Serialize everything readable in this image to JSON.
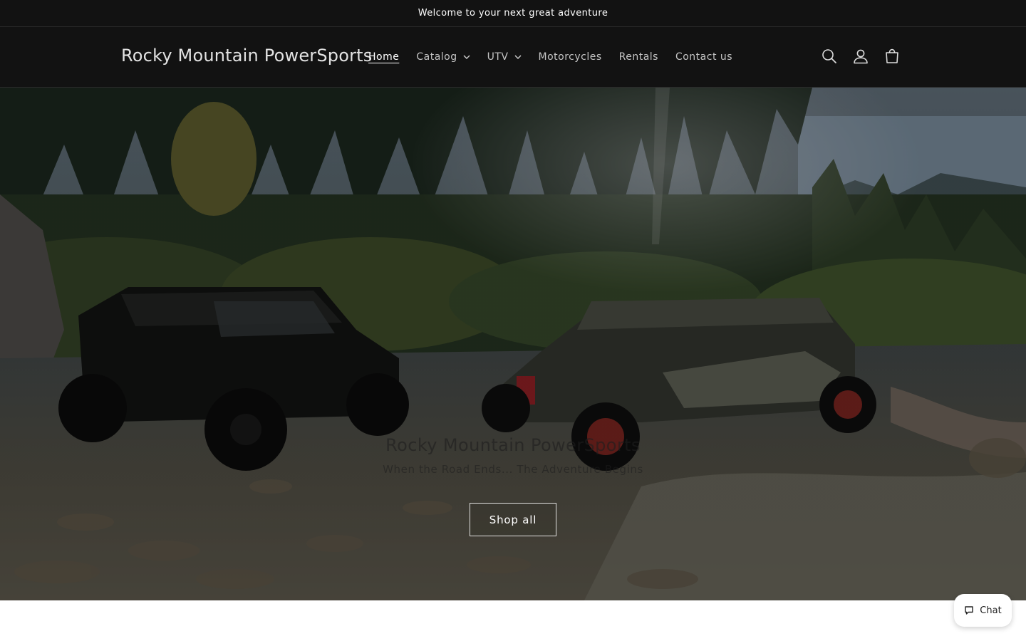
{
  "announcement": {
    "text": "Welcome to your next great adventure"
  },
  "header": {
    "brand": "Rocky Mountain PowerSports",
    "nav": [
      {
        "label": "Home",
        "active": true,
        "has_dropdown": false
      },
      {
        "label": "Catalog",
        "active": false,
        "has_dropdown": true
      },
      {
        "label": "UTV",
        "active": false,
        "has_dropdown": true
      },
      {
        "label": "Motorcycles",
        "active": false,
        "has_dropdown": false
      },
      {
        "label": "Rentals",
        "active": false,
        "has_dropdown": false
      },
      {
        "label": "Contact us",
        "active": false,
        "has_dropdown": false
      }
    ],
    "icons": [
      "search-icon",
      "account-icon",
      "cart-icon"
    ]
  },
  "hero": {
    "title": "Rocky Mountain PowerSports",
    "subtitle": "When the Road Ends... The Adventure Begins",
    "button_label": "Shop all"
  },
  "chat": {
    "label": "Chat"
  },
  "colors": {
    "header_bg": "#121212",
    "header_text": "#ffffff",
    "page_bg": "#ffffff"
  }
}
